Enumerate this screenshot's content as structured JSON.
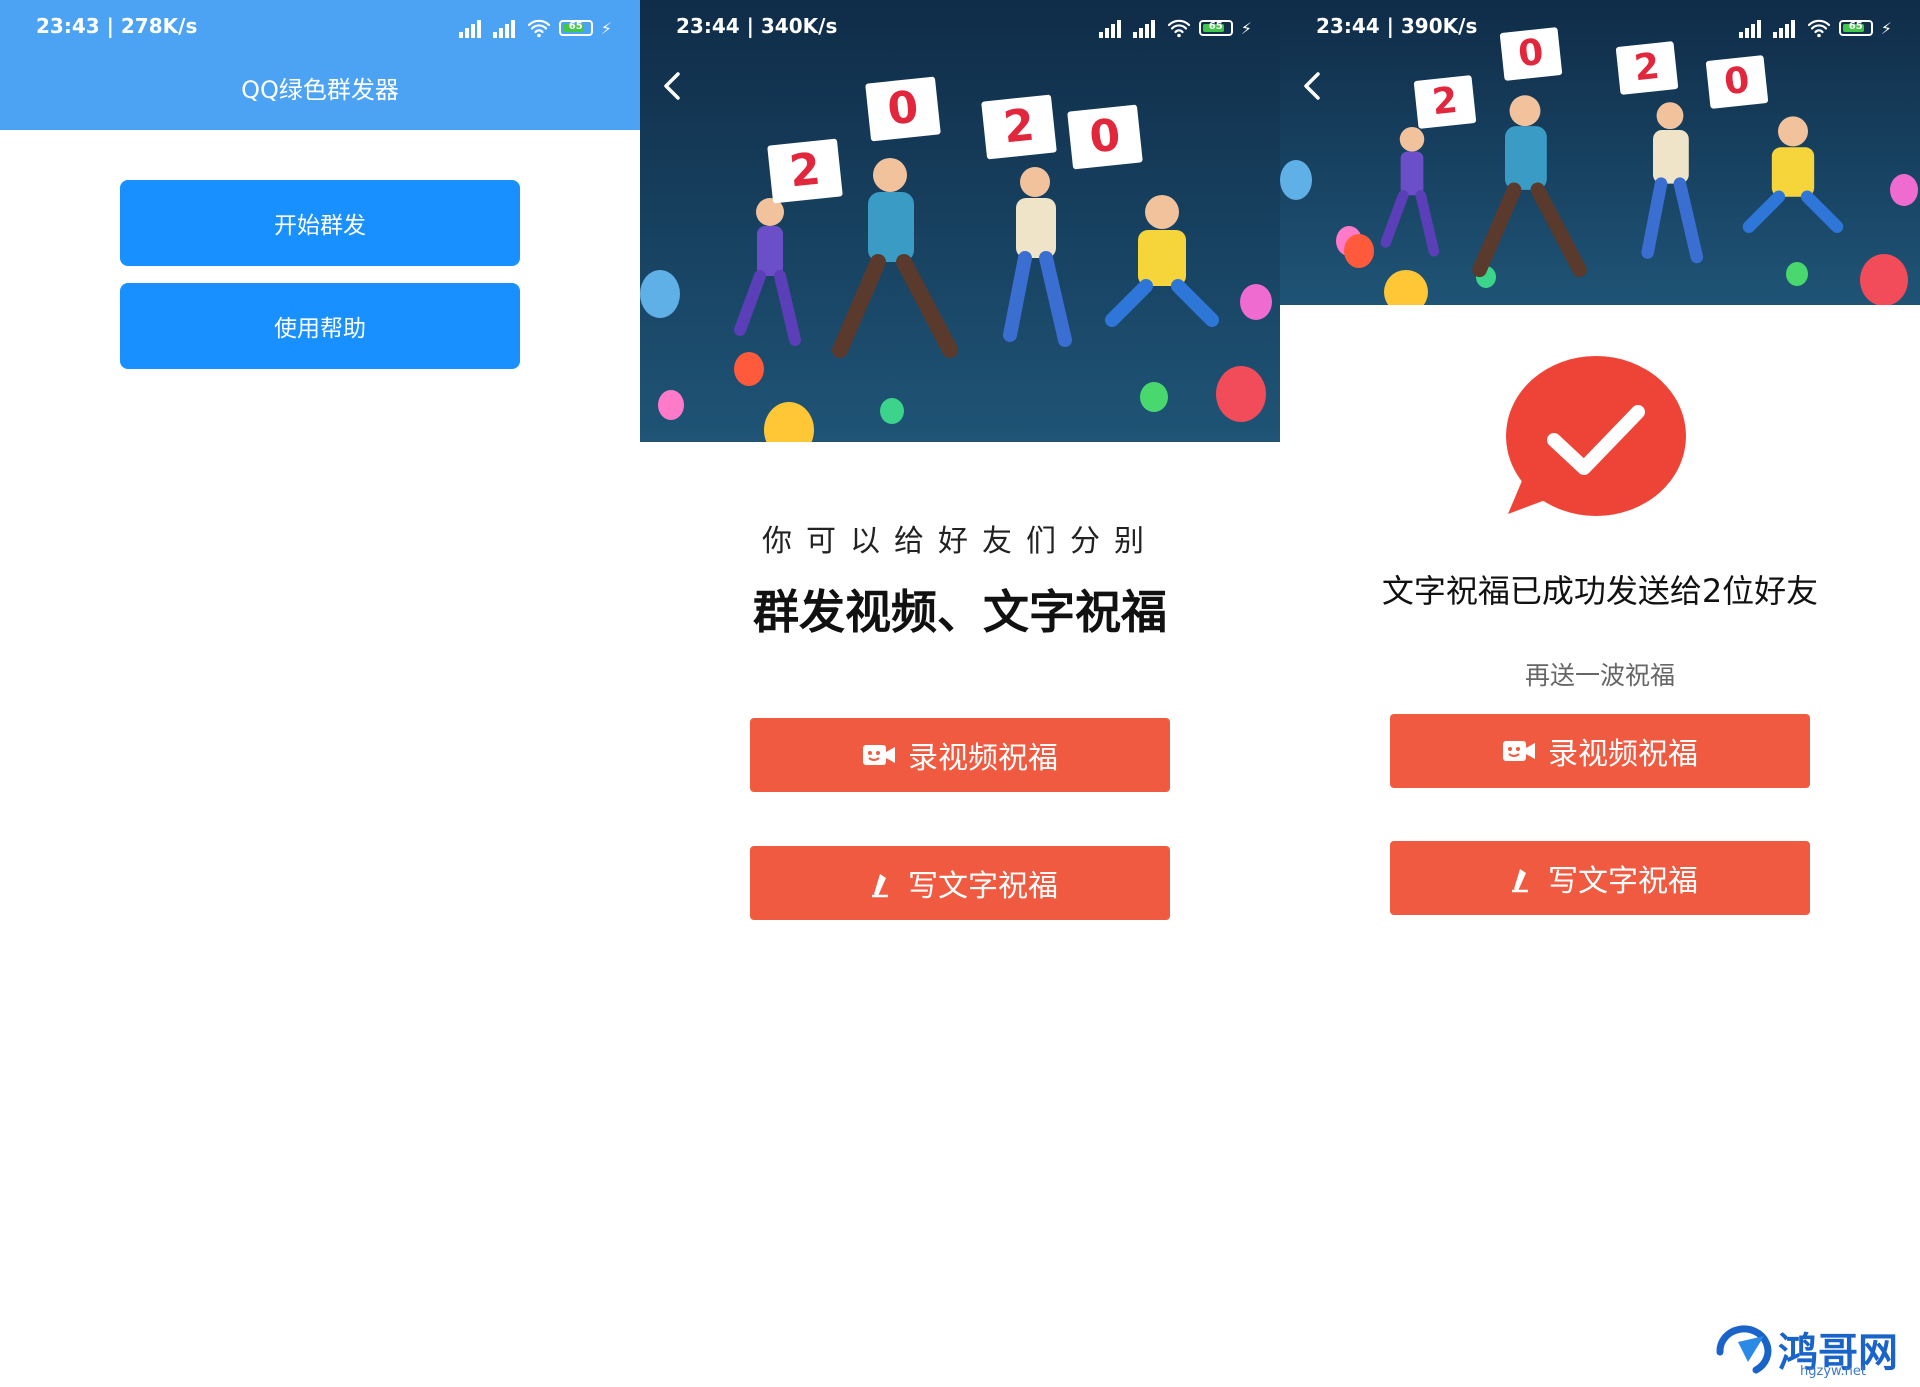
{
  "screens": [
    {
      "status": {
        "time": "23:43 | 278K/s",
        "battery": "65"
      },
      "header": {
        "title": "QQ绿色群发器"
      },
      "buttons": {
        "start": "开始群发",
        "help": "使用帮助"
      }
    },
    {
      "status": {
        "time": "23:44 | 340K/s",
        "battery": "65"
      },
      "banner": {
        "digits": [
          "2",
          "0",
          "2",
          "0"
        ]
      },
      "subtitle": "你可以给好友们分别",
      "headline": "群发视频、文字祝福",
      "buttons": {
        "video": "录视频祝福",
        "text": "写文字祝福"
      }
    },
    {
      "status": {
        "time": "23:44 | 390K/s",
        "battery": "65"
      },
      "banner": {
        "digits": [
          "2",
          "0",
          "2",
          "0"
        ]
      },
      "success_message": "文字祝福已成功发送给2位好友",
      "again_link": "再送一波祝福",
      "buttons": {
        "video": "录视频祝福",
        "text": "写文字祝福"
      }
    }
  ],
  "watermark": {
    "name": "鸿哥网",
    "url": "hgzyw.net"
  },
  "colors": {
    "header_blue": "#4ca2f3",
    "primary_blue": "#1890ff",
    "action_red": "#f05a40",
    "success_red": "#ee4437",
    "banner_navy": "#0f2c48"
  },
  "icons": [
    "back-arrow-icon",
    "video-camera-icon",
    "pen-icon",
    "checkmark-icon",
    "signal-icon",
    "wifi-icon",
    "battery-icon",
    "charging-icon"
  ]
}
